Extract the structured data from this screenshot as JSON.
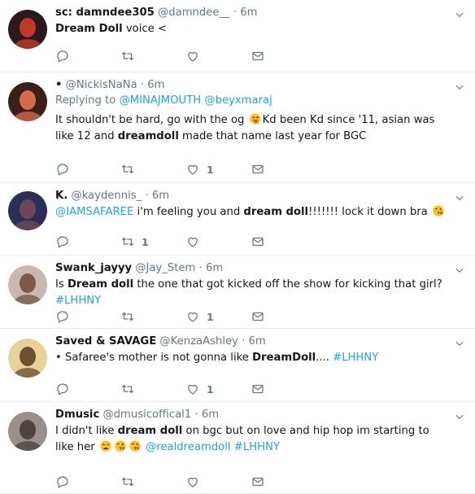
{
  "tweets": [
    {
      "name": "sc: damndee305",
      "handle": "@damndee__",
      "time": "6m",
      "text_parts": [
        {
          "t": "b",
          "v": "Dream Doll"
        },
        {
          "t": "s",
          "v": " voice <"
        }
      ],
      "reply_count": "",
      "retweet_count": "",
      "like_count": ""
    },
    {
      "name": "•",
      "handle": "@NickisNaNa",
      "time": "6m",
      "replying_label": "Replying to",
      "replying_to": [
        "@MINAJMOUTH",
        "@beyxmaraj"
      ],
      "text_parts": [
        {
          "t": "s",
          "v": "It shouldn't be hard, go with the og "
        },
        {
          "t": "e",
          "v": "winking-tongue-emoji"
        },
        {
          "t": "s",
          "v": "Kd been Kd since '11, asian was like 12 and "
        },
        {
          "t": "b",
          "v": "dreamdoll"
        },
        {
          "t": "s",
          "v": " made that name last year for BGC"
        }
      ],
      "reply_count": "",
      "retweet_count": "",
      "like_count": "1"
    },
    {
      "name": "K.",
      "handle": "@kaydennis_",
      "time": "6m",
      "text_parts": [
        {
          "t": "l",
          "v": "@IAMSAFAREE"
        },
        {
          "t": "s",
          "v": " i'm feeling you and "
        },
        {
          "t": "b",
          "v": "dream doll"
        },
        {
          "t": "s",
          "v": "!!!!!!! lock it down bra "
        },
        {
          "t": "e",
          "v": "kiss-emoji"
        }
      ],
      "reply_count": "",
      "retweet_count": "1",
      "like_count": ""
    },
    {
      "name": "Swank_jayyy",
      "handle": "@Jay_Stem",
      "time": "6m",
      "text_parts": [
        {
          "t": "s",
          "v": "Is "
        },
        {
          "t": "b",
          "v": "Dream doll"
        },
        {
          "t": "s",
          "v": " the one that got kicked off the show for kicking that girl? "
        },
        {
          "t": "l",
          "v": "#LHHNY"
        }
      ],
      "reply_count": "",
      "retweet_count": "",
      "like_count": "1"
    },
    {
      "name": "Saved & SAVAGE",
      "handle": "@KenzaAshley",
      "time": "6m",
      "text_parts": [
        {
          "t": "s",
          "v": "• Safaree's mother is not gonna like "
        },
        {
          "t": "b",
          "v": "DreamDoll"
        },
        {
          "t": "s",
          "v": ".... "
        },
        {
          "t": "l",
          "v": "#LHHNY"
        }
      ],
      "reply_count": "",
      "retweet_count": "",
      "like_count": "1"
    },
    {
      "name": "Dmusic",
      "handle": "@dmusicoffical1",
      "time": "6m",
      "text_parts": [
        {
          "t": "s",
          "v": "I didn't like "
        },
        {
          "t": "b",
          "v": "dream doll"
        },
        {
          "t": "s",
          "v": " on bgc but on love and hip hop im starting to like her "
        },
        {
          "t": "e",
          "v": "weary-emoji"
        },
        {
          "t": "e",
          "v": "kiss-emoji"
        },
        {
          "t": "e",
          "v": "kiss-emoji"
        },
        {
          "t": "s",
          "v": " "
        },
        {
          "t": "l",
          "v": "@realdreamdoll"
        },
        {
          "t": "s",
          "v": " "
        },
        {
          "t": "l",
          "v": "#LHHNY"
        }
      ],
      "reply_count": "",
      "retweet_count": "",
      "like_count": ""
    }
  ],
  "colors": {
    "accent": "#1da1f2",
    "muted": "#657786",
    "border": "#e6ecf0"
  },
  "icons": {
    "reply": "reply-icon",
    "retweet": "retweet-icon",
    "like": "heart-icon",
    "dm": "envelope-icon",
    "menu": "chevron-down-icon"
  }
}
